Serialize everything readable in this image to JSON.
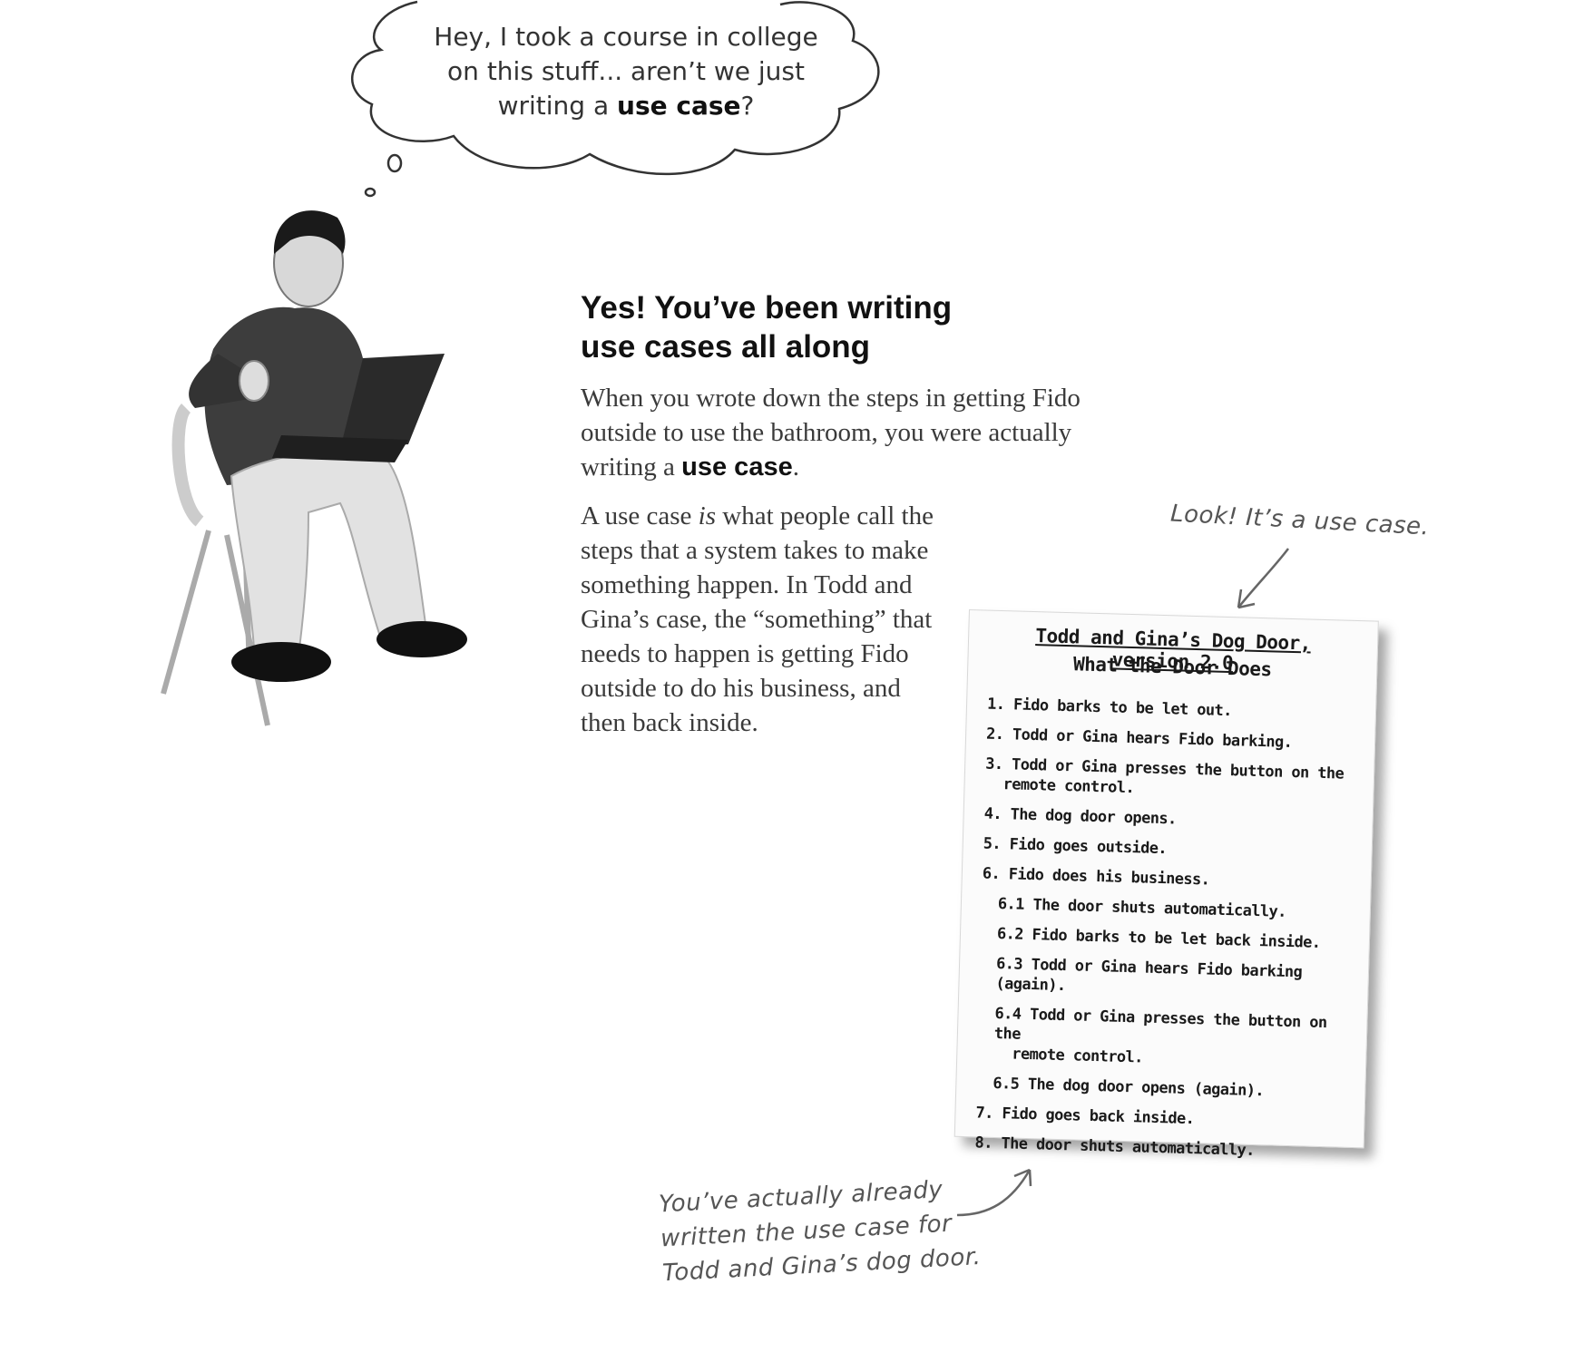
{
  "bubble": {
    "line1": "Hey, I took a course in college",
    "line2": "on this stuff... aren’t we just",
    "line3_pre": "writing a ",
    "line3_bold": "use case",
    "line3_post": "?"
  },
  "heading": {
    "line1": "Yes! You’ve been writing",
    "line2": "use cases all along"
  },
  "para1": {
    "text": "When you wrote down the steps in getting Fido outside to use the bathroom, you were actually writing a ",
    "bold": "use case",
    "end": "."
  },
  "para2": {
    "pre": "A use case ",
    "italic": "is",
    "rest": " what people call the steps that a system takes to make something happen. In Todd and Gina’s case, the “something” that needs to happen is getting Fido outside to do his business, and then back inside."
  },
  "notes": {
    "top": "Look! It’s a use case.",
    "bottom": "You’ve actually already written the use case for Todd and Gina’s dog door."
  },
  "card": {
    "title": "Todd and Gina’s Dog Door, version 2.0",
    "subtitle": "What the Door Does",
    "steps": [
      {
        "num": "1.",
        "text": "Fido barks to be let out."
      },
      {
        "num": "2.",
        "text": "Todd or Gina hears Fido barking."
      },
      {
        "num": "3.",
        "text": "Todd or Gina presses the button on the",
        "cont": "remote control."
      },
      {
        "num": "4.",
        "text": "The dog door opens."
      },
      {
        "num": "5.",
        "text": "Fido goes outside."
      },
      {
        "num": "6.",
        "text": "Fido does his business."
      },
      {
        "num": "6.1",
        "text": "The door shuts automatically."
      },
      {
        "num": "6.2",
        "text": "Fido barks to be let back inside."
      },
      {
        "num": "6.3",
        "text": "Todd or Gina hears Fido barking (again)."
      },
      {
        "num": "6.4",
        "text": "Todd or Gina presses the button on the",
        "cont": "remote control."
      },
      {
        "num": "6.5",
        "text": "The dog door opens (again)."
      },
      {
        "num": "7.",
        "text": "Fido goes back inside."
      },
      {
        "num": "8.",
        "text": "The door shuts automatically."
      }
    ]
  }
}
